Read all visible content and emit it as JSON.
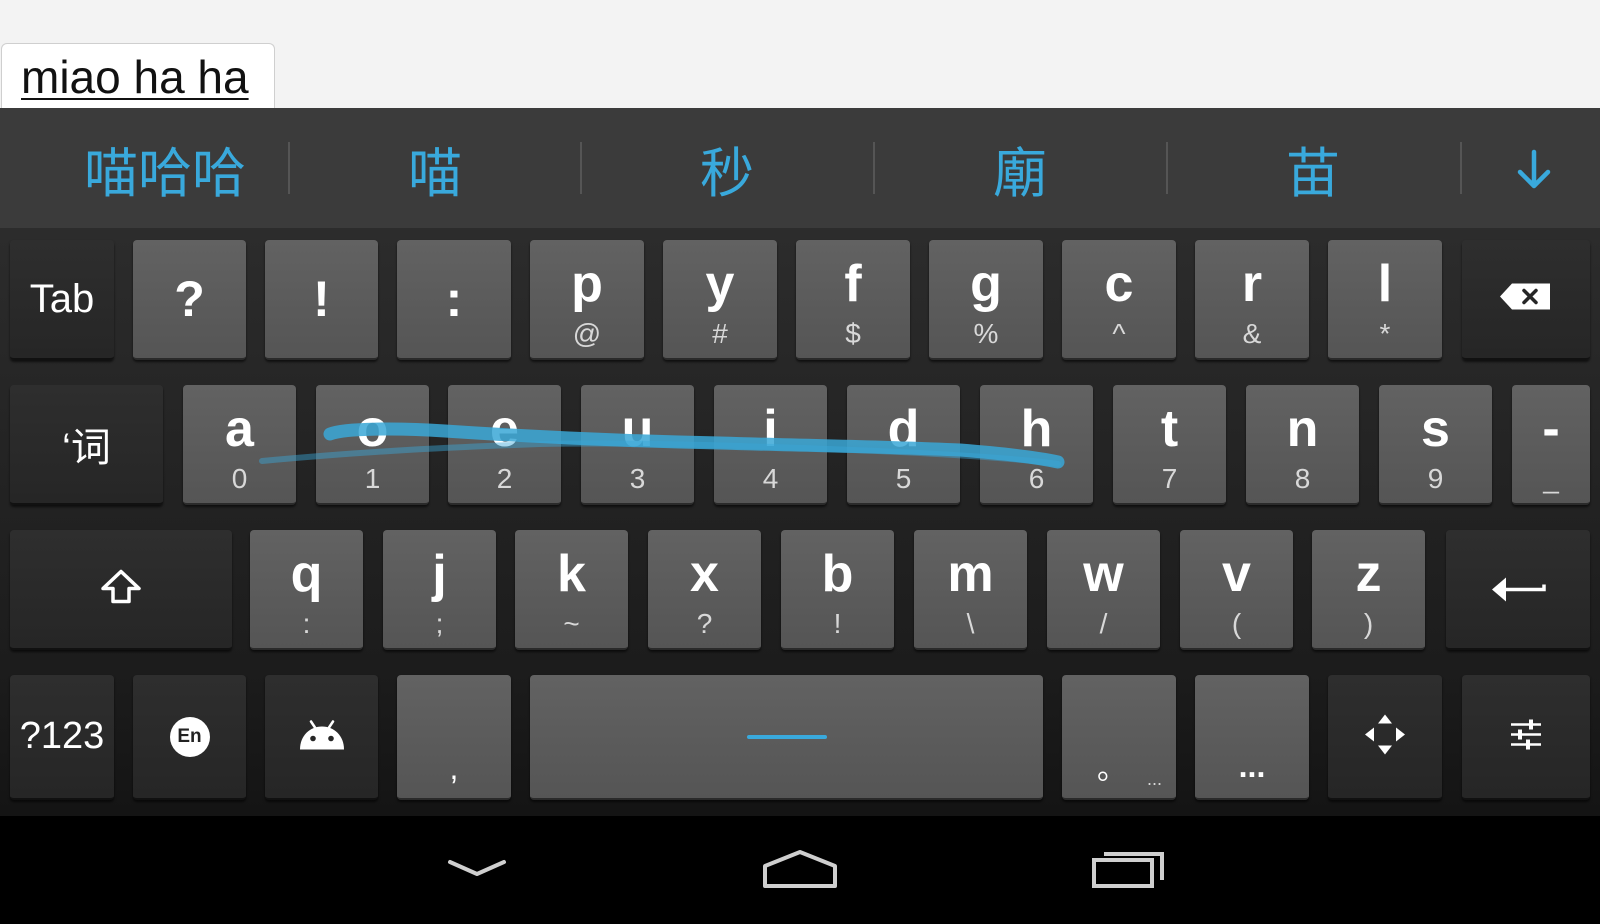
{
  "text_field": {
    "value": "miao ha ha"
  },
  "candidates": {
    "items": [
      "喵哈哈",
      "喵",
      "秒",
      "廟",
      "苗"
    ],
    "expand_icon": "arrow-down-icon",
    "color": "#39a9dc"
  },
  "keyboard": {
    "row1": [
      {
        "main": "Tab"
      },
      {
        "main": "?"
      },
      {
        "main": "!"
      },
      {
        "main": ":"
      },
      {
        "main": "p",
        "sub": "@"
      },
      {
        "main": "y",
        "sub": "#"
      },
      {
        "main": "f",
        "sub": "$"
      },
      {
        "main": "g",
        "sub": "%"
      },
      {
        "main": "c",
        "sub": "^"
      },
      {
        "main": "r",
        "sub": "&"
      },
      {
        "main": "l",
        "sub": "*"
      },
      {
        "icon": "backspace-icon"
      }
    ],
    "row2": [
      {
        "main": "‘词"
      },
      {
        "main": "a",
        "sub": "0"
      },
      {
        "main": "o",
        "sub": "1"
      },
      {
        "main": "e",
        "sub": "2"
      },
      {
        "main": "u",
        "sub": "3"
      },
      {
        "main": "i",
        "sub": "4"
      },
      {
        "main": "d",
        "sub": "5"
      },
      {
        "main": "h",
        "sub": "6"
      },
      {
        "main": "t",
        "sub": "7"
      },
      {
        "main": "n",
        "sub": "8"
      },
      {
        "main": "s",
        "sub": "9"
      },
      {
        "main": "-",
        "sub": "_"
      }
    ],
    "row3": [
      {
        "icon": "shift-icon"
      },
      {
        "main": "q",
        "sub": ":"
      },
      {
        "main": "j",
        "sub": ";"
      },
      {
        "main": "k",
        "sub": "~"
      },
      {
        "main": "x",
        "sub": "?"
      },
      {
        "main": "b",
        "sub": "!"
      },
      {
        "main": "m",
        "sub": "\\"
      },
      {
        "main": "w",
        "sub": "/"
      },
      {
        "main": "v",
        "sub": "("
      },
      {
        "main": "z",
        "sub": ")"
      },
      {
        "icon": "enter-icon"
      }
    ],
    "row4": [
      {
        "main": "?123"
      },
      {
        "main": "En",
        "icon": "language-switch-icon"
      },
      {
        "icon": "android-emoji-icon"
      },
      {
        "main": ","
      },
      {
        "icon": "space-icon"
      },
      {
        "main": "。",
        "sub": "..."
      },
      {
        "main": "..."
      },
      {
        "icon": "move-cursor-icon"
      },
      {
        "icon": "settings-sliders-icon"
      }
    ],
    "swipe_color": "#3aa7d6"
  },
  "navbar": {
    "back_icon": "back-chevron-down-icon",
    "home_icon": "home-icon",
    "recents_icon": "recent-apps-icon"
  }
}
